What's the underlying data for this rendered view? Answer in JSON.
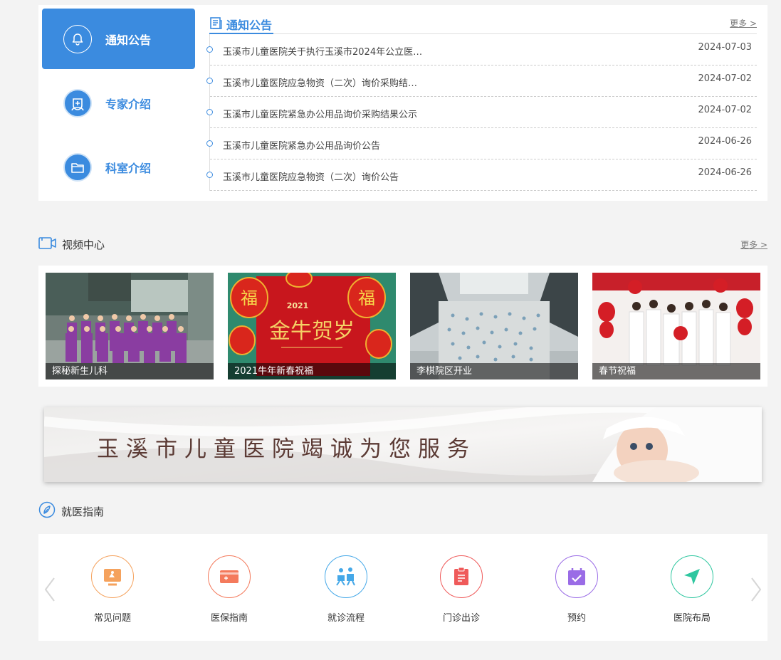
{
  "notice": {
    "tabs": [
      {
        "label": "通知公告"
      },
      {
        "label": "专家介绍"
      },
      {
        "label": "科室介绍"
      }
    ],
    "heading": "通知公告",
    "more": "更多 >",
    "items": [
      {
        "title": "玉溪市儿童医院关于执行玉溪市2024年公立医…",
        "date": "2024-07-03"
      },
      {
        "title": "玉溪市儿童医院应急物资（二次）询价采购结…",
        "date": "2024-07-02"
      },
      {
        "title": "玉溪市儿童医院紧急办公用品询价采购结果公示",
        "date": "2024-07-02"
      },
      {
        "title": "玉溪市儿童医院紧急办公用品询价公告",
        "date": "2024-06-26"
      },
      {
        "title": "玉溪市儿童医院应急物资（二次）询价公告",
        "date": "2024-06-26"
      }
    ]
  },
  "video": {
    "heading": "视频中心",
    "more": "更多 >",
    "items": [
      {
        "caption": "探秘新生儿科"
      },
      {
        "caption": "2021牛年新春祝福"
      },
      {
        "caption": "李棋院区开业"
      },
      {
        "caption": "春节祝福"
      }
    ],
    "thumb2_text": "金牛贺岁",
    "thumb2_year": "2021"
  },
  "banner": {
    "text": "玉溪市儿童医院竭诚为您服务"
  },
  "guide": {
    "heading": "就医指南",
    "items": [
      {
        "label": "常见问题",
        "color": "#f5a25d"
      },
      {
        "label": "医保指南",
        "color": "#f47a5c"
      },
      {
        "label": "就诊流程",
        "color": "#45a8e8"
      },
      {
        "label": "门诊出诊",
        "color": "#ef5a5a"
      },
      {
        "label": "预约",
        "color": "#9a6ce6"
      },
      {
        "label": "医院布局",
        "color": "#2fc7a0"
      }
    ]
  },
  "colors": {
    "accent": "#3b8bdf"
  }
}
